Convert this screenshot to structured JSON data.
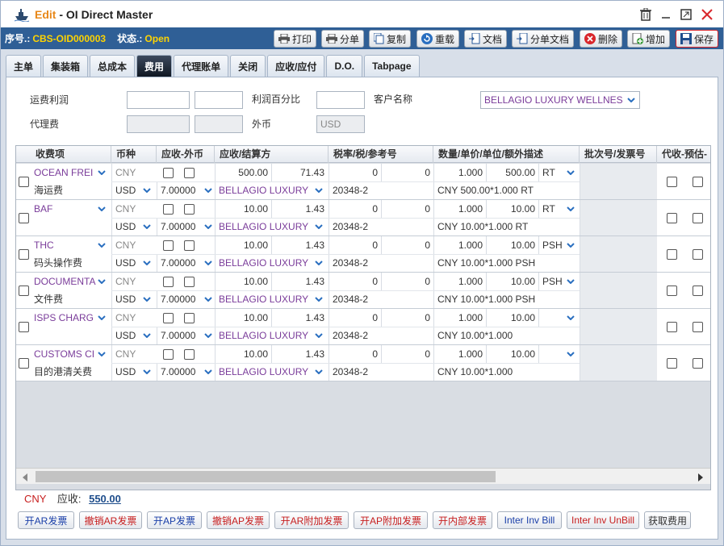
{
  "window": {
    "edit_word": "Edit",
    "title": "OI Direct Master"
  },
  "toolbar": {
    "seq_label": "序号.:",
    "seq_value": "CBS-OID000003",
    "status_label": "状态.:",
    "status_value": "Open",
    "buttons": {
      "print": "打印",
      "split": "分单",
      "copy": "复制",
      "reload": "重载",
      "docs": "文档",
      "split_docs": "分单文档",
      "delete": "删除",
      "add": "增加",
      "save": "保存"
    }
  },
  "tabs": [
    "主单",
    "集装箱",
    "总成本",
    "费用",
    "代理账单",
    "关闭",
    "应收/应付",
    "D.O.",
    "Tabpage"
  ],
  "form": {
    "freight_profit_label": "运费利润",
    "profit_pct_label": "利润百分比",
    "customer_label": "客户名称",
    "customer_value": "BELLAGIO LUXURY WELLNES",
    "agent_fee_label": "代理费",
    "fx_label": "外币",
    "fx_value": "USD"
  },
  "grid": {
    "headers": [
      "收费项",
      "币种",
      "应收-外币",
      "应收/结算方",
      "税率/税/参考号",
      "数量/单价/单位/额外描述",
      "批次号/发票号",
      "代收-预估-"
    ],
    "rows": [
      {
        "code": "OCEAN FREI",
        "desc": "海运费",
        "cur1": "CNY",
        "cur2": "USD",
        "rate": "7.00000",
        "amt": "500.00",
        "fx": "71.43",
        "party": "BELLAGIO LUXURY",
        "tax1": "0",
        "tax2": "0",
        "ref": "20348-2",
        "qty": "1.000",
        "price": "500.00",
        "unit": "RT",
        "extra": "CNY 500.00*1.000 RT"
      },
      {
        "code": "BAF",
        "desc": "",
        "cur1": "CNY",
        "cur2": "USD",
        "rate": "7.00000",
        "amt": "10.00",
        "fx": "1.43",
        "party": "BELLAGIO LUXURY",
        "tax1": "0",
        "tax2": "0",
        "ref": "20348-2",
        "qty": "1.000",
        "price": "10.00",
        "unit": "RT",
        "extra": "CNY 10.00*1.000 RT"
      },
      {
        "code": "THC",
        "desc": "码头操作费",
        "cur1": "CNY",
        "cur2": "USD",
        "rate": "7.00000",
        "amt": "10.00",
        "fx": "1.43",
        "party": "BELLAGIO LUXURY",
        "tax1": "0",
        "tax2": "0",
        "ref": "20348-2",
        "qty": "1.000",
        "price": "10.00",
        "unit": "PSH",
        "extra": "CNY 10.00*1.000 PSH"
      },
      {
        "code": "DOCUMENTA",
        "desc": "文件费",
        "cur1": "CNY",
        "cur2": "USD",
        "rate": "7.00000",
        "amt": "10.00",
        "fx": "1.43",
        "party": "BELLAGIO LUXURY",
        "tax1": "0",
        "tax2": "0",
        "ref": "20348-2",
        "qty": "1.000",
        "price": "10.00",
        "unit": "PSH",
        "extra": "CNY 10.00*1.000 PSH"
      },
      {
        "code": "ISPS CHARG",
        "desc": "",
        "cur1": "CNY",
        "cur2": "USD",
        "rate": "7.00000",
        "amt": "10.00",
        "fx": "1.43",
        "party": "BELLAGIO LUXURY",
        "tax1": "0",
        "tax2": "0",
        "ref": "20348-2",
        "qty": "1.000",
        "price": "10.00",
        "unit": "",
        "extra": "CNY 10.00*1.000"
      },
      {
        "code": "CUSTOMS CI",
        "desc": "目的港清关费",
        "cur1": "CNY",
        "cur2": "USD",
        "rate": "7.00000",
        "amt": "10.00",
        "fx": "1.43",
        "party": "BELLAGIO LUXURY",
        "tax1": "0",
        "tax2": "0",
        "ref": "20348-2",
        "qty": "1.000",
        "price": "10.00",
        "unit": "",
        "extra": "CNY 10.00*1.000"
      }
    ]
  },
  "summary": {
    "currency": "CNY",
    "ar_label": "应收:",
    "ar_value": "550.00"
  },
  "bottom_buttons": [
    {
      "label": "开AR发票",
      "color": "blue"
    },
    {
      "label": "撤销AR发票",
      "color": "red"
    },
    {
      "label": "开AP发票",
      "color": "blue"
    },
    {
      "label": "撤销AP发票",
      "color": "red"
    },
    {
      "label": "开AR附加发票",
      "color": "red"
    },
    {
      "label": "开AP附加发票",
      "color": "red"
    },
    {
      "label": "开内部发票",
      "color": "red"
    },
    {
      "label": "Inter Inv Bill",
      "color": "blue"
    },
    {
      "label": "Inter Inv UnBill",
      "color": "red"
    },
    {
      "label": "获取费用",
      "color": "dk"
    }
  ]
}
